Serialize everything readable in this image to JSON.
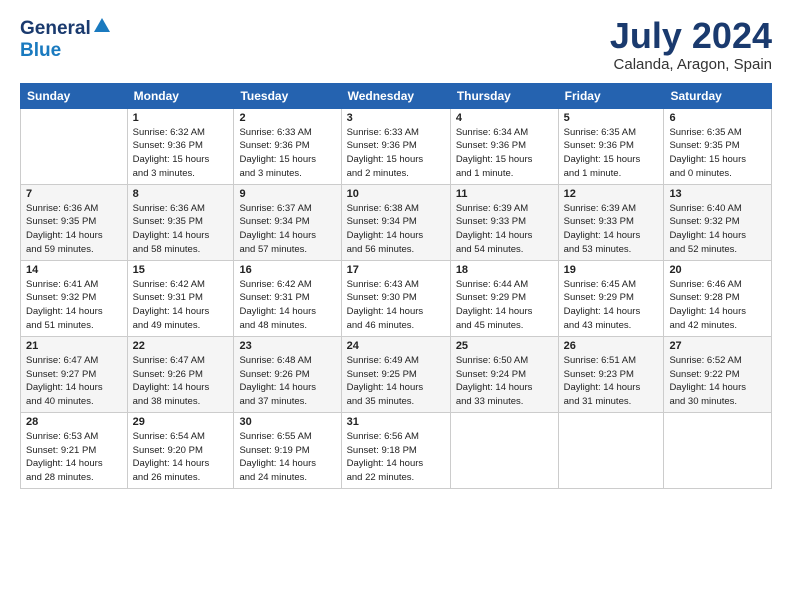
{
  "header": {
    "logo_general": "General",
    "logo_blue": "Blue",
    "title": "July 2024",
    "location": "Calanda, Aragon, Spain"
  },
  "calendar": {
    "days_of_week": [
      "Sunday",
      "Monday",
      "Tuesday",
      "Wednesday",
      "Thursday",
      "Friday",
      "Saturday"
    ],
    "weeks": [
      [
        {
          "day": "",
          "info": ""
        },
        {
          "day": "1",
          "info": "Sunrise: 6:32 AM\nSunset: 9:36 PM\nDaylight: 15 hours\nand 3 minutes."
        },
        {
          "day": "2",
          "info": "Sunrise: 6:33 AM\nSunset: 9:36 PM\nDaylight: 15 hours\nand 3 minutes."
        },
        {
          "day": "3",
          "info": "Sunrise: 6:33 AM\nSunset: 9:36 PM\nDaylight: 15 hours\nand 2 minutes."
        },
        {
          "day": "4",
          "info": "Sunrise: 6:34 AM\nSunset: 9:36 PM\nDaylight: 15 hours\nand 1 minute."
        },
        {
          "day": "5",
          "info": "Sunrise: 6:35 AM\nSunset: 9:36 PM\nDaylight: 15 hours\nand 1 minute."
        },
        {
          "day": "6",
          "info": "Sunrise: 6:35 AM\nSunset: 9:35 PM\nDaylight: 15 hours\nand 0 minutes."
        }
      ],
      [
        {
          "day": "7",
          "info": "Sunrise: 6:36 AM\nSunset: 9:35 PM\nDaylight: 14 hours\nand 59 minutes."
        },
        {
          "day": "8",
          "info": "Sunrise: 6:36 AM\nSunset: 9:35 PM\nDaylight: 14 hours\nand 58 minutes."
        },
        {
          "day": "9",
          "info": "Sunrise: 6:37 AM\nSunset: 9:34 PM\nDaylight: 14 hours\nand 57 minutes."
        },
        {
          "day": "10",
          "info": "Sunrise: 6:38 AM\nSunset: 9:34 PM\nDaylight: 14 hours\nand 56 minutes."
        },
        {
          "day": "11",
          "info": "Sunrise: 6:39 AM\nSunset: 9:33 PM\nDaylight: 14 hours\nand 54 minutes."
        },
        {
          "day": "12",
          "info": "Sunrise: 6:39 AM\nSunset: 9:33 PM\nDaylight: 14 hours\nand 53 minutes."
        },
        {
          "day": "13",
          "info": "Sunrise: 6:40 AM\nSunset: 9:32 PM\nDaylight: 14 hours\nand 52 minutes."
        }
      ],
      [
        {
          "day": "14",
          "info": "Sunrise: 6:41 AM\nSunset: 9:32 PM\nDaylight: 14 hours\nand 51 minutes."
        },
        {
          "day": "15",
          "info": "Sunrise: 6:42 AM\nSunset: 9:31 PM\nDaylight: 14 hours\nand 49 minutes."
        },
        {
          "day": "16",
          "info": "Sunrise: 6:42 AM\nSunset: 9:31 PM\nDaylight: 14 hours\nand 48 minutes."
        },
        {
          "day": "17",
          "info": "Sunrise: 6:43 AM\nSunset: 9:30 PM\nDaylight: 14 hours\nand 46 minutes."
        },
        {
          "day": "18",
          "info": "Sunrise: 6:44 AM\nSunset: 9:29 PM\nDaylight: 14 hours\nand 45 minutes."
        },
        {
          "day": "19",
          "info": "Sunrise: 6:45 AM\nSunset: 9:29 PM\nDaylight: 14 hours\nand 43 minutes."
        },
        {
          "day": "20",
          "info": "Sunrise: 6:46 AM\nSunset: 9:28 PM\nDaylight: 14 hours\nand 42 minutes."
        }
      ],
      [
        {
          "day": "21",
          "info": "Sunrise: 6:47 AM\nSunset: 9:27 PM\nDaylight: 14 hours\nand 40 minutes."
        },
        {
          "day": "22",
          "info": "Sunrise: 6:47 AM\nSunset: 9:26 PM\nDaylight: 14 hours\nand 38 minutes."
        },
        {
          "day": "23",
          "info": "Sunrise: 6:48 AM\nSunset: 9:26 PM\nDaylight: 14 hours\nand 37 minutes."
        },
        {
          "day": "24",
          "info": "Sunrise: 6:49 AM\nSunset: 9:25 PM\nDaylight: 14 hours\nand 35 minutes."
        },
        {
          "day": "25",
          "info": "Sunrise: 6:50 AM\nSunset: 9:24 PM\nDaylight: 14 hours\nand 33 minutes."
        },
        {
          "day": "26",
          "info": "Sunrise: 6:51 AM\nSunset: 9:23 PM\nDaylight: 14 hours\nand 31 minutes."
        },
        {
          "day": "27",
          "info": "Sunrise: 6:52 AM\nSunset: 9:22 PM\nDaylight: 14 hours\nand 30 minutes."
        }
      ],
      [
        {
          "day": "28",
          "info": "Sunrise: 6:53 AM\nSunset: 9:21 PM\nDaylight: 14 hours\nand 28 minutes."
        },
        {
          "day": "29",
          "info": "Sunrise: 6:54 AM\nSunset: 9:20 PM\nDaylight: 14 hours\nand 26 minutes."
        },
        {
          "day": "30",
          "info": "Sunrise: 6:55 AM\nSunset: 9:19 PM\nDaylight: 14 hours\nand 24 minutes."
        },
        {
          "day": "31",
          "info": "Sunrise: 6:56 AM\nSunset: 9:18 PM\nDaylight: 14 hours\nand 22 minutes."
        },
        {
          "day": "",
          "info": ""
        },
        {
          "day": "",
          "info": ""
        },
        {
          "day": "",
          "info": ""
        }
      ]
    ]
  }
}
